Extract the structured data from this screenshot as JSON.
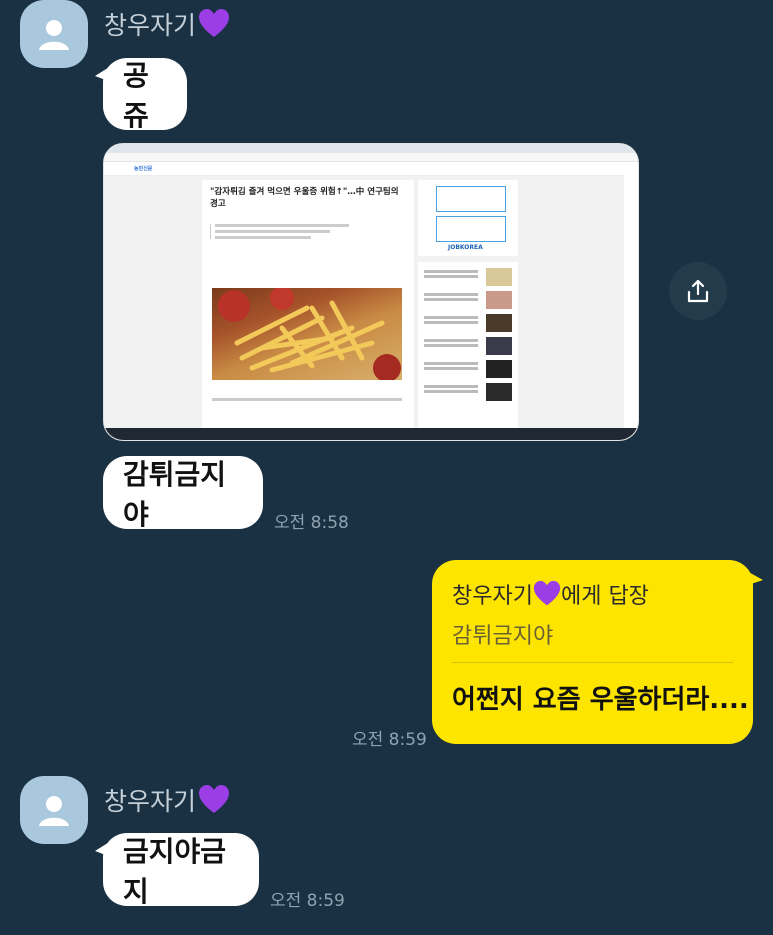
{
  "messages": {
    "first_sender": {
      "name": "창우자기",
      "heart_icon": "purple-heart-icon"
    },
    "first_bubble": "공쥬",
    "image_preview": {
      "site_name": "농민신문",
      "headline": "\"감자튀김 즐겨 먹으면 우울증 위험↑\"…中 연구팀의 경고",
      "ad_label": "JOBKOREA"
    },
    "second_bubble": "감튀금지야",
    "second_time": "오전 8:58",
    "reply": {
      "header": "창우자기💜에게 답장",
      "header_name": "창우자기",
      "header_suffix": "에게 답장",
      "quote": "감튀금지야",
      "text": "어쩐지 요즘 우울하더라...."
    },
    "reply_time": "오전 8:59",
    "second_sender": {
      "name": "창우자기"
    },
    "third_bubble": "금지야금지",
    "third_time": "오전 8:59"
  },
  "colors": {
    "background": "#193142",
    "my_bubble": "#fde500",
    "their_bubble": "#ffffff",
    "heart": "#9b3ee6"
  }
}
